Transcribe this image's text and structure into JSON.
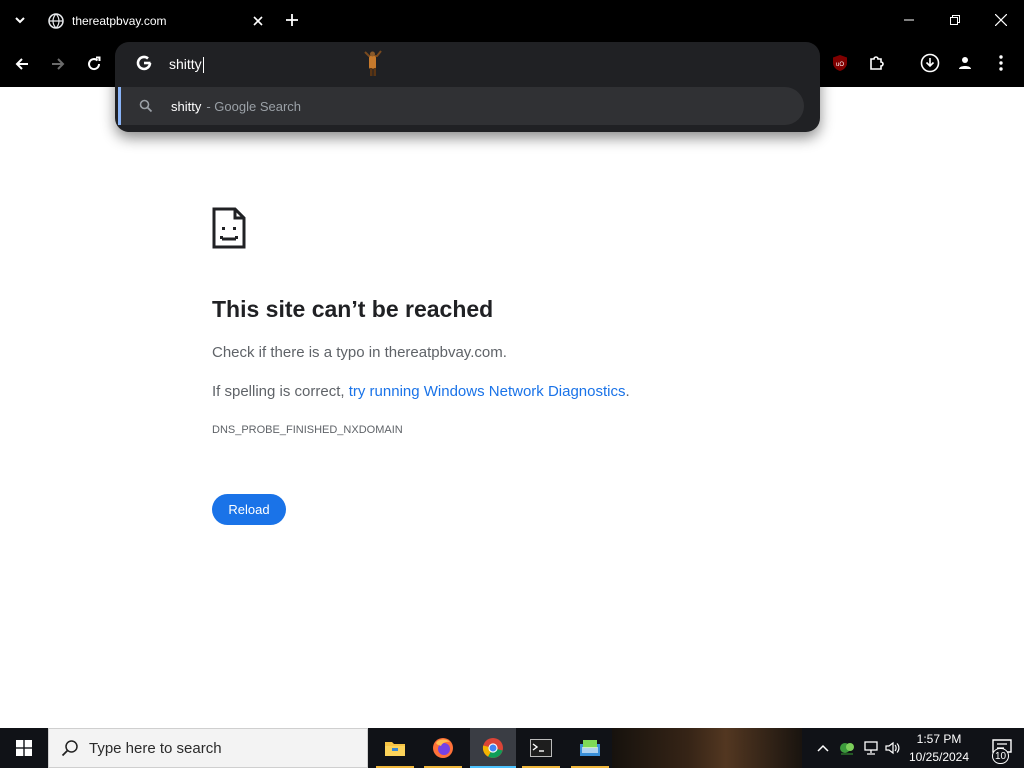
{
  "browser": {
    "tab": {
      "title": "thereatpbvay.com",
      "favicon": "globe-icon"
    },
    "omnibox": {
      "value": "shitty",
      "suggestion": {
        "query": "shitty",
        "source": "- Google Search",
        "icon": "search-icon"
      }
    }
  },
  "error_page": {
    "title": "This site can’t be reached",
    "line1": "Check if there is a typo in thereatpbvay.com.",
    "line2_prefix": "If spelling is correct, ",
    "line2_link": "try running Windows Network Diagnostics",
    "line2_suffix": ".",
    "error_code": "DNS_PROBE_FINISHED_NXDOMAIN",
    "reload_label": "Reload"
  },
  "taskbar": {
    "search_placeholder": "Type here to search",
    "apps": [
      "file-explorer-icon",
      "firefox-icon",
      "chrome-icon",
      "terminal-icon",
      "app-icon"
    ],
    "active_app": "chrome-icon",
    "time": "1:57 PM",
    "date": "10/25/2024",
    "notification_count": "10"
  },
  "colors": {
    "accent_blue": "#1a73e8",
    "chrome_dark": "#000000",
    "omnibox_bg": "#202124"
  }
}
